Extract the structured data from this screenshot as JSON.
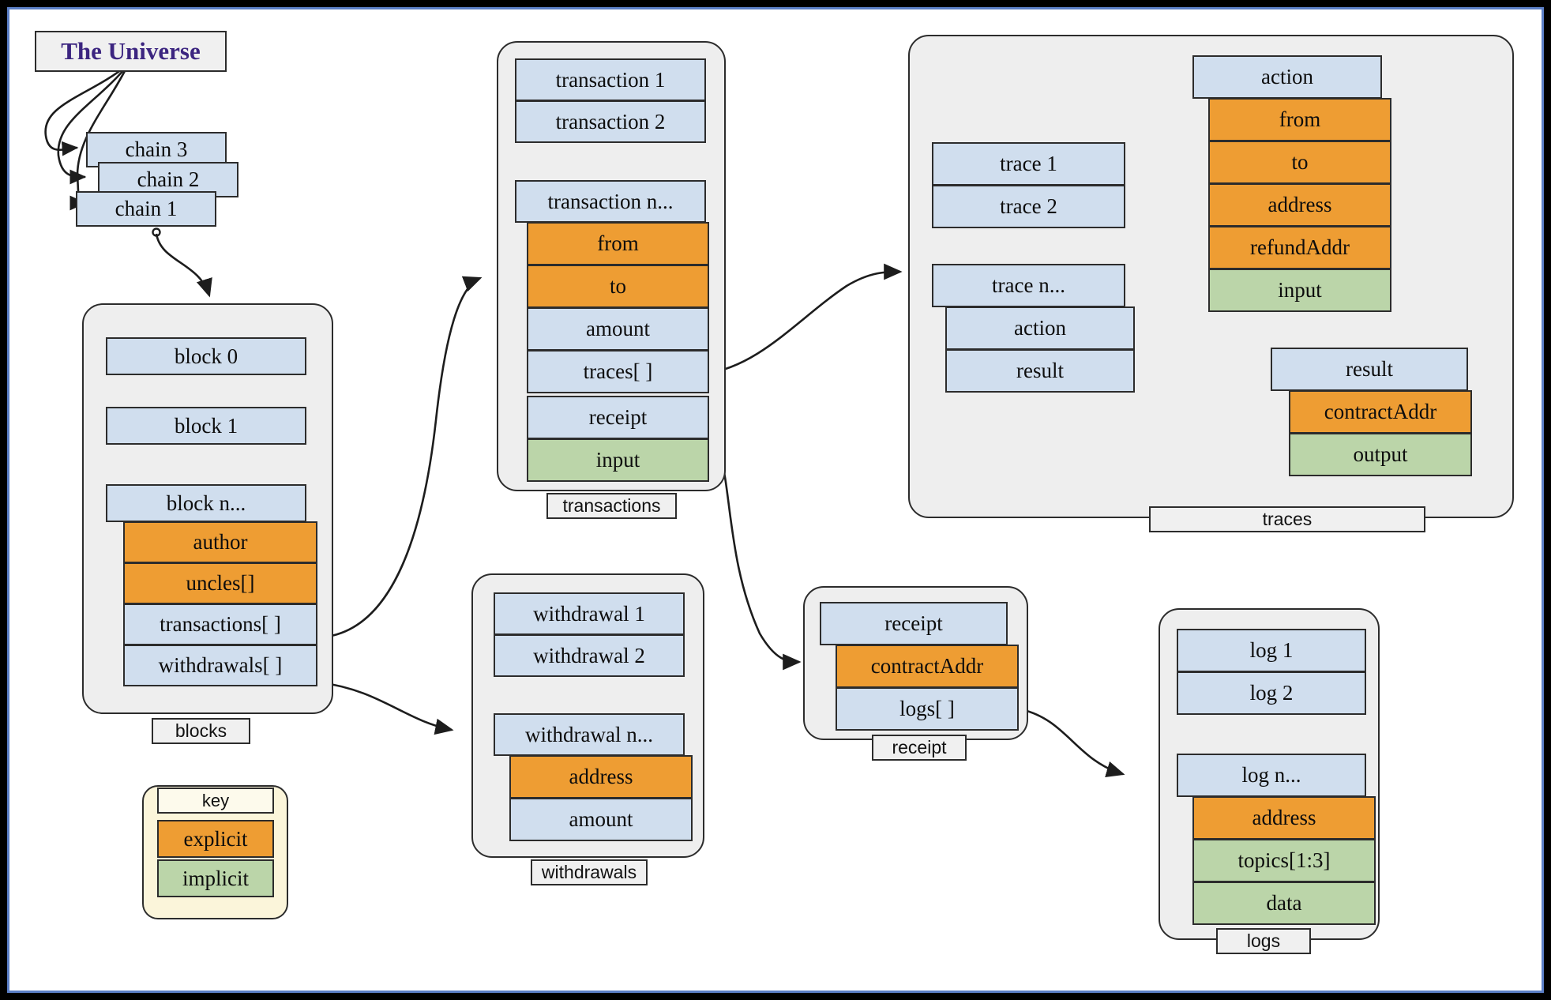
{
  "diagram": {
    "title": "The Universe",
    "universe": {
      "label": "The Universe"
    },
    "chains": [
      {
        "label": "chain 3"
      },
      {
        "label": "chain 2"
      },
      {
        "label": "chain 1"
      }
    ],
    "key": {
      "header": "key",
      "explicit": "explicit",
      "implicit": "implicit"
    },
    "colors": {
      "explicit": "#ee9d33",
      "implicit": "#bbd5a9",
      "entity": "#d0deee",
      "group_bg": "#eeeeee",
      "key_bg": "#fbf5da",
      "border": "#2c2c2c",
      "title_text": "#3c2580",
      "frame_accent": "#5b7fc7"
    },
    "groups": {
      "blocks": {
        "label": "blocks",
        "items": [
          {
            "label": "block 0",
            "kind": "entity"
          },
          {
            "label": "block 1",
            "kind": "entity"
          },
          {
            "label": "block n...",
            "kind": "entity"
          }
        ],
        "fields": [
          {
            "label": "author",
            "kind": "explicit"
          },
          {
            "label": "uncles[]",
            "kind": "explicit"
          },
          {
            "label": "transactions[ ]",
            "kind": "entity"
          },
          {
            "label": "withdrawals[ ]",
            "kind": "entity"
          }
        ]
      },
      "transactions": {
        "label": "transactions",
        "items": [
          {
            "label": "transaction 1",
            "kind": "entity"
          },
          {
            "label": "transaction 2",
            "kind": "entity"
          },
          {
            "label": "transaction n...",
            "kind": "entity"
          }
        ],
        "fields": [
          {
            "label": "from",
            "kind": "explicit"
          },
          {
            "label": "to",
            "kind": "explicit"
          },
          {
            "label": "amount",
            "kind": "entity"
          },
          {
            "label": "traces[ ]",
            "kind": "entity"
          },
          {
            "label": "receipt",
            "kind": "entity"
          },
          {
            "label": "input",
            "kind": "implicit"
          }
        ]
      },
      "withdrawals": {
        "label": "withdrawals",
        "items": [
          {
            "label": "withdrawal 1",
            "kind": "entity"
          },
          {
            "label": "withdrawal 2",
            "kind": "entity"
          },
          {
            "label": "withdrawal n...",
            "kind": "entity"
          }
        ],
        "fields": [
          {
            "label": "address",
            "kind": "explicit"
          },
          {
            "label": "amount",
            "kind": "entity"
          }
        ]
      },
      "traces": {
        "label": "traces",
        "items": [
          {
            "label": "trace 1",
            "kind": "entity"
          },
          {
            "label": "trace 2",
            "kind": "entity"
          },
          {
            "label": "trace n...",
            "kind": "entity"
          }
        ],
        "fields": [
          {
            "label": "action",
            "kind": "entity"
          },
          {
            "label": "result",
            "kind": "entity"
          }
        ],
        "action": {
          "header": "action",
          "fields": [
            {
              "label": "from",
              "kind": "explicit"
            },
            {
              "label": "to",
              "kind": "explicit"
            },
            {
              "label": "address",
              "kind": "explicit"
            },
            {
              "label": "refundAddr",
              "kind": "explicit"
            },
            {
              "label": "input",
              "kind": "implicit"
            }
          ]
        },
        "result": {
          "header": "result",
          "fields": [
            {
              "label": "contractAddr",
              "kind": "explicit"
            },
            {
              "label": "output",
              "kind": "implicit"
            }
          ]
        }
      },
      "receipt": {
        "label": "receipt",
        "header": "receipt",
        "fields": [
          {
            "label": "contractAddr",
            "kind": "explicit"
          },
          {
            "label": "logs[ ]",
            "kind": "entity"
          }
        ]
      },
      "logs": {
        "label": "logs",
        "items": [
          {
            "label": "log 1",
            "kind": "entity"
          },
          {
            "label": "log 2",
            "kind": "entity"
          },
          {
            "label": "log n...",
            "kind": "entity"
          }
        ],
        "fields": [
          {
            "label": "address",
            "kind": "explicit"
          },
          {
            "label": "topics[1:3]",
            "kind": "implicit"
          },
          {
            "label": "data",
            "kind": "implicit"
          }
        ]
      }
    }
  }
}
